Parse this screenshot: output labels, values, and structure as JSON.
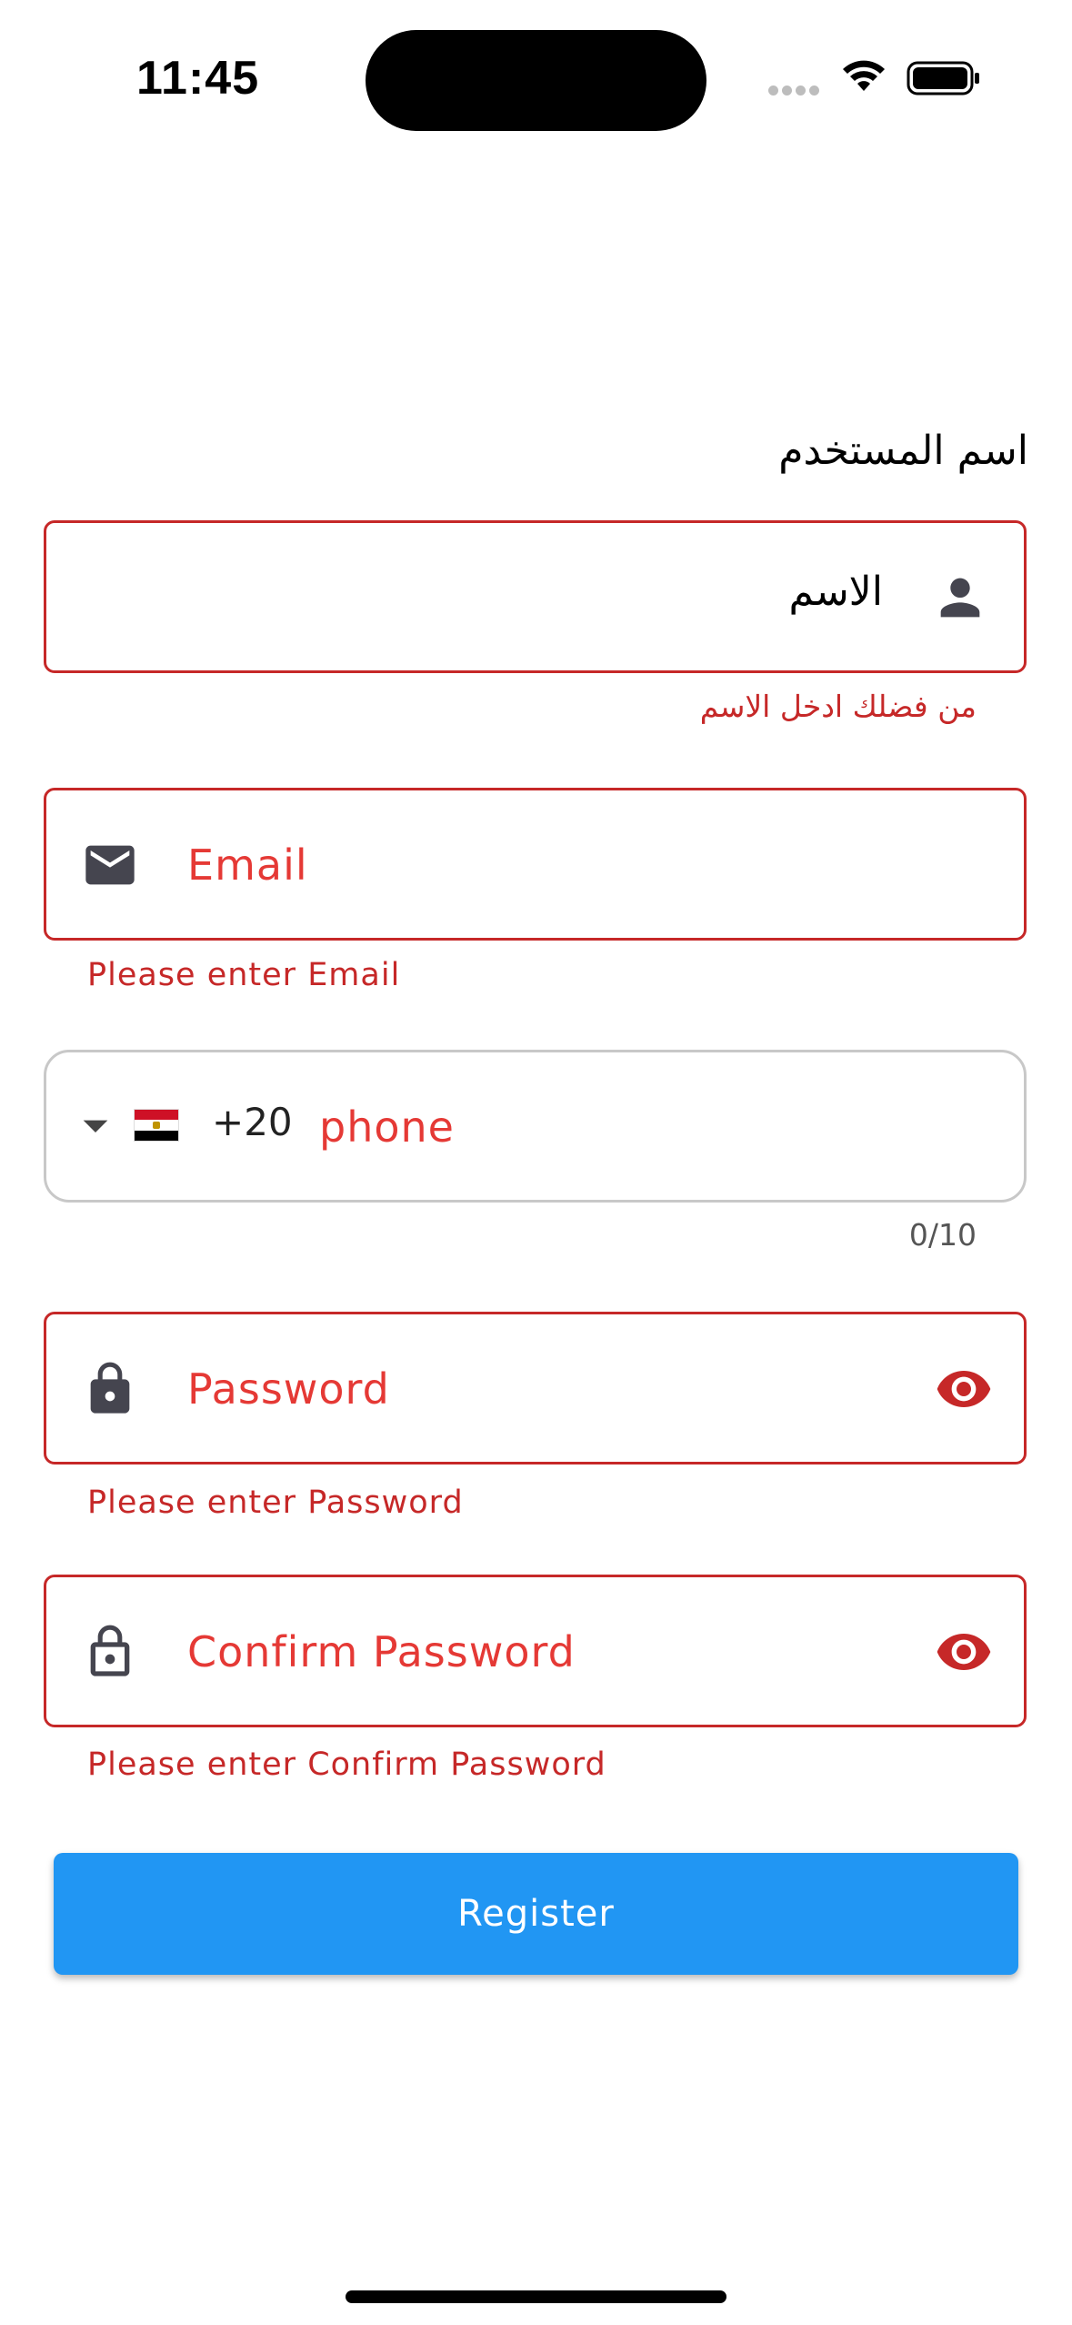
{
  "status_bar": {
    "time": "11:45"
  },
  "form": {
    "name": {
      "label": "اسم المستخدم",
      "placeholder": "الاسم",
      "error": "من فضلك ادخل الاسم",
      "icon": "person-icon"
    },
    "email": {
      "placeholder": "Email",
      "error": "Please enter Email",
      "icon": "mail-icon"
    },
    "phone": {
      "country_flag": "egypt-flag-icon",
      "dial_code": "+20",
      "placeholder": "phone",
      "counter": "0/10",
      "icon": "dropdown-arrow-icon"
    },
    "password": {
      "placeholder": "Password",
      "error": "Please enter Password",
      "icon": "lock-icon",
      "toggle_icon": "eye-icon"
    },
    "confirm_password": {
      "placeholder": "Confirm Password",
      "error": "Please enter Confirm Password",
      "icon": "lock-outline-icon",
      "toggle_icon": "eye-icon"
    },
    "submit_label": "Register"
  },
  "colors": {
    "error": "#c62828",
    "hint": "#e53935",
    "primary": "#2196f3",
    "icon": "#45454f"
  }
}
